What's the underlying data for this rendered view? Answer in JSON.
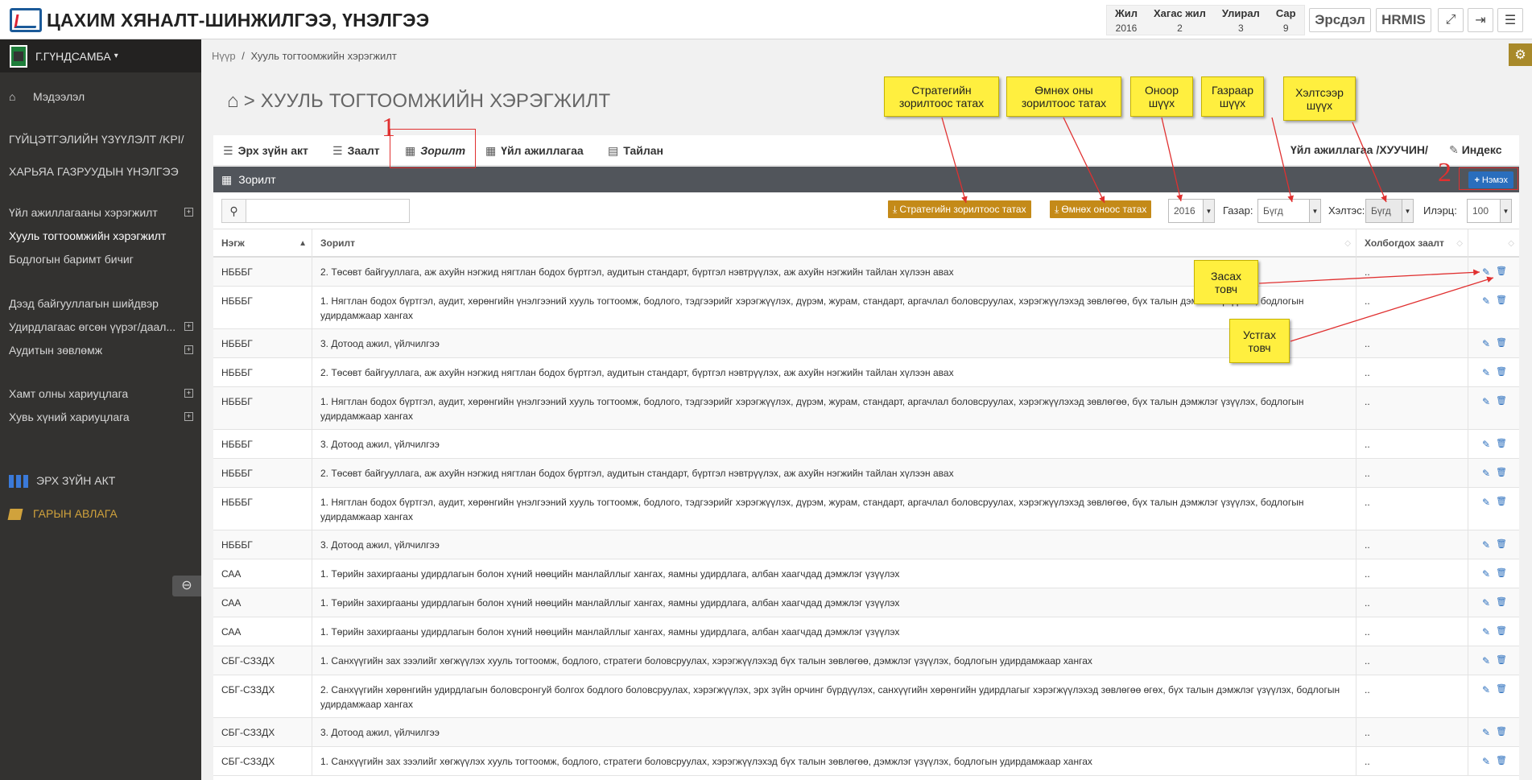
{
  "app": {
    "title": "ЦАХИМ ХЯНАЛТ-ШИНЖИЛГЭЭ, ҮНЭЛГЭЭ"
  },
  "period": [
    {
      "label": "Жил",
      "value": "2016"
    },
    {
      "label": "Хагас жил",
      "value": "2"
    },
    {
      "label": "Улирал",
      "value": "3"
    },
    {
      "label": "Сар",
      "value": "9"
    }
  ],
  "top_buttons": {
    "ersdel": "Эрсдэл",
    "hrmis": "HRMIS"
  },
  "user": {
    "name": "Г.ГҮНДСАМБА"
  },
  "sidebar": {
    "items": [
      {
        "label": "Мэдээлэл"
      },
      {
        "label": "ГҮЙЦЭТГЭЛИЙН ҮЗҮҮЛЭЛТ /KPI/"
      },
      {
        "label": "ХАРЬЯА ГАЗРУУДЫН ҮНЭЛГЭЭ"
      },
      {
        "label": "Үйл ажиллагааны хэрэгжилт"
      },
      {
        "label": "Хууль тогтоомжийн хэрэгжилт"
      },
      {
        "label": "Бодлогын баримт бичиг"
      },
      {
        "label": "Дээд байгууллагын шийдвэр"
      },
      {
        "label": "Удирдлагаас өгсөн үүрэг/даал..."
      },
      {
        "label": "Аудитын зөвлөмж"
      },
      {
        "label": "Хамт олны хариуцлага"
      },
      {
        "label": "Хувь хүний хариуцлага"
      },
      {
        "label": "ЭРХ ЗҮЙН АКТ"
      },
      {
        "label": "ГАРЫН АВЛАГА"
      }
    ]
  },
  "breadcrumb": {
    "home": "Нүүр",
    "sep": "/",
    "current": "Хууль тогтоомжийн хэрэгжилт"
  },
  "page": {
    "title": "> ХУУЛЬ ТОГТООМЖИЙН ХЭРЭГЖИЛТ"
  },
  "tabs": [
    {
      "label": "Эрх зүйн акт"
    },
    {
      "label": "Заалт"
    },
    {
      "label": "Зорилт"
    },
    {
      "label": "Үйл ажиллагаа"
    },
    {
      "label": "Тайлан"
    }
  ],
  "tabs_right": {
    "activity": "Үйл ажиллагаа /ХУУЧИН/",
    "index": "Индекс"
  },
  "panel": {
    "title": "Зорилт",
    "add_label": "Нэмэх"
  },
  "toolbar": {
    "search_placeholder": "",
    "btn_strategy": "Стратегийн зорилтоос татах",
    "btn_prev_year": "Өмнөх оноос татах",
    "year": "2016",
    "gazar_label": "Газар:",
    "gazar_value": "Бүгд",
    "heltes_label": "Хэлтэс:",
    "heltes_value": "Бүгд",
    "ilerts_label": "Илэрц:",
    "ilerts_value": "100"
  },
  "table": {
    "headers": [
      "Нэгж",
      "Зорилт",
      "Холбогдох заалт"
    ],
    "rows": [
      {
        "unit": "НБББГ",
        "goal": "2. Төсөвт байгууллага, аж ахуйн нэгжид нягтлан бодох бүртгэл, аудитын стандарт, бүртгэл нэвтрүүлэх, аж ахуйн нэгжийн тайлан хүлээн авах",
        "ref": ".."
      },
      {
        "unit": "НБББГ",
        "goal": "1. Нягтлан бодох бүртгэл, аудит, хөрөнгийн үнэлгээний хууль тогтоомж, бодлого, тэдгээрийг хэрэгжүүлэх, дүрэм, журам, стандарт, аргачлал боловсруулах, хэрэгжүүлэхэд зөвлөгөө, бүх талын дэмжлэг үзүүлэх, бодлогын удирдамжаар хангах",
        "ref": ".."
      },
      {
        "unit": "НБББГ",
        "goal": "3. Дотоод ажил, үйлчилгээ",
        "ref": ".."
      },
      {
        "unit": "НБББГ",
        "goal": "2. Төсөвт байгууллага, аж ахуйн нэгжид нягтлан бодох бүртгэл, аудитын стандарт, бүртгэл нэвтрүүлэх, аж ахуйн нэгжийн тайлан хүлээн авах",
        "ref": ".."
      },
      {
        "unit": "НБББГ",
        "goal": "1. Нягтлан бодох бүртгэл, аудит, хөрөнгийн үнэлгээний хууль тогтоомж, бодлого, тэдгээрийг хэрэгжүүлэх, дүрэм, журам, стандарт, аргачлал боловсруулах, хэрэгжүүлэхэд зөвлөгөө, бүх талын дэмжлэг үзүүлэх, бодлогын удирдамжаар хангах",
        "ref": ".."
      },
      {
        "unit": "НБББГ",
        "goal": "3. Дотоод ажил, үйлчилгээ",
        "ref": ".."
      },
      {
        "unit": "НБББГ",
        "goal": "2. Төсөвт байгууллага, аж ахуйн нэгжид нягтлан бодох бүртгэл, аудитын стандарт, бүртгэл нэвтрүүлэх, аж ахуйн нэгжийн тайлан хүлээн авах",
        "ref": ".."
      },
      {
        "unit": "НБББГ",
        "goal": "1. Нягтлан бодох бүртгэл, аудит, хөрөнгийн үнэлгээний хууль тогтоомж, бодлого, тэдгээрийг хэрэгжүүлэх, дүрэм, журам, стандарт, аргачлал боловсруулах, хэрэгжүүлэхэд зөвлөгөө, бүх талын дэмжлэг үзүүлэх, бодлогын удирдамжаар хангах",
        "ref": ".."
      },
      {
        "unit": "НБББГ",
        "goal": "3. Дотоод ажил, үйлчилгээ",
        "ref": ".."
      },
      {
        "unit": "САА",
        "goal": "1. Төрийн захиргааны удирдлагын болон хүний нөөцийн манлайллыг хангах, яамны удирдлага, албан хаагчдад дэмжлэг үзүүлэх",
        "ref": ".."
      },
      {
        "unit": "САА",
        "goal": "1. Төрийн захиргааны удирдлагын болон хүний нөөцийн манлайллыг хангах, яамны удирдлага, албан хаагчдад дэмжлэг үзүүлэх",
        "ref": ".."
      },
      {
        "unit": "САА",
        "goal": "1. Төрийн захиргааны удирдлагын болон хүний нөөцийн манлайллыг хангах, яамны удирдлага, албан хаагчдад дэмжлэг үзүүлэх",
        "ref": ".."
      },
      {
        "unit": "СБГ-СЗЗДХ",
        "goal": "1. Санхүүгийн зах зээлийг хөгжүүлэх хууль тогтоомж, бодлого, стратеги боловсруулах, хэрэгжүүлэхэд бүх талын зөвлөгөө, дэмжлэг үзүүлэх, бодлогын удирдамжаар хангах",
        "ref": ".."
      },
      {
        "unit": "СБГ-СЗЗДХ",
        "goal": "2. Санхүүгийн хөрөнгийн удирдлагын боловсронгуй болгох бодлого боловсруулах, хэрэгжүүлэх, эрх зүйн орчинг бүрдүүлэх, санхүүгийн хөрөнгийн удирдлагыг хэрэгжүүлэхэд зөвлөгөө өгөх, бүх талын дэмжлэг үзүүлэх, бодлогын удирдамжаар хангах",
        "ref": ".."
      },
      {
        "unit": "СБГ-СЗЗДХ",
        "goal": "3. Дотоод ажил, үйлчилгээ",
        "ref": ".."
      },
      {
        "unit": "СБГ-СЗЗДХ",
        "goal": "1. Санхүүгийн зах зээлийг хөгжүүлэх хууль тогтоомж, бодлого, стратеги боловсруулах, хэрэгжүүлэхэд бүх талын зөвлөгөө, дэмжлэг үзүүлэх, бодлогын удирдамжаар хангах",
        "ref": ".."
      }
    ]
  },
  "callouts": {
    "strategy": "Стратегийн зорилтоос татах",
    "prev_year": "Өмнөх оны зорилтоос татах",
    "year_filter": "Оноор шүүх",
    "gazar_filter": "Газраар шүүх",
    "heltes_filter": "Хэлтсээр шүүх",
    "edit": "Засах товч",
    "delete": "Устгах товч",
    "num1": "1",
    "num2": "2"
  },
  "colors": {
    "accent": "#2a6ebd",
    "gold": "#c48a18",
    "sidebar": "#333230",
    "callout": "#ffef3f",
    "annotation": "#e03030"
  }
}
